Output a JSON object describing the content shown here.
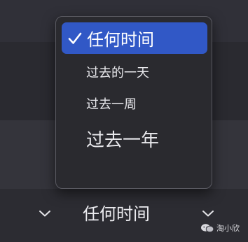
{
  "menu": {
    "selected_label": "任何时间",
    "selected_icon": "checkmark-icon",
    "options": [
      {
        "label": "过去的一天"
      },
      {
        "label": "过去一周"
      },
      {
        "label": "过去一年"
      }
    ],
    "highlight_color": "#3158c6"
  },
  "footer": {
    "left_icon": "chevron-down-icon",
    "label": "任何时间",
    "right_icon": "chevron-down-icon"
  },
  "watermark": {
    "icon": "wechat-logo-icon",
    "text": "淘小欣"
  }
}
